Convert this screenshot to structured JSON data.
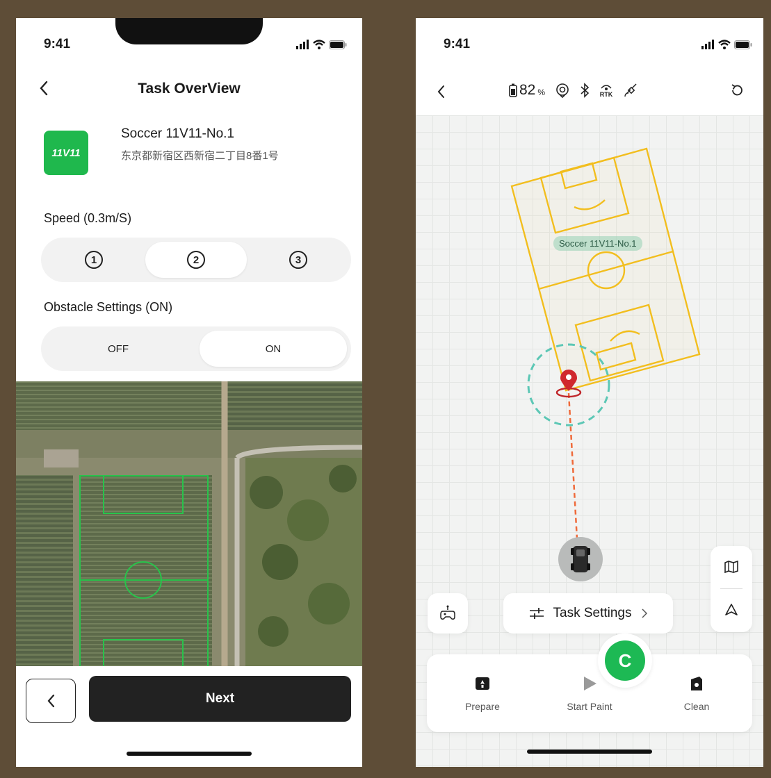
{
  "left": {
    "status": {
      "time": "9:41"
    },
    "header": {
      "title": "Task OverView"
    },
    "task": {
      "badge": "11V11",
      "name": "Soccer 11V11-No.1",
      "address": "东京都新宿区西新宿二丁目8番1号"
    },
    "speed": {
      "label": "Speed (0.3m/S)",
      "options": [
        "1",
        "2",
        "3"
      ],
      "selected": "2"
    },
    "obstacle": {
      "label": "Obstacle Settings (ON)",
      "options": [
        "OFF",
        "ON"
      ],
      "selected": "ON"
    },
    "footer": {
      "next_label": "Next"
    }
  },
  "right": {
    "status": {
      "time": "9:41"
    },
    "toolbar": {
      "battery": "82",
      "battery_unit": "%",
      "rtk_label": "RTK"
    },
    "map": {
      "field_label": "Soccer 11V11-No.1"
    },
    "task_settings_label": "Task Settings",
    "avatar_letter": "C",
    "actions": [
      {
        "label": "Prepare",
        "icon": "prepare-icon"
      },
      {
        "label": "Start Paint",
        "icon": "play-icon"
      },
      {
        "label": "Clean",
        "icon": "clean-icon"
      }
    ]
  },
  "colors": {
    "brand_green": "#1db954",
    "field_yellow": "#f2be1e",
    "marker_red": "#d0282e",
    "dashed_teal": "#5cc7b5",
    "path_orange": "#ef6a3a"
  }
}
